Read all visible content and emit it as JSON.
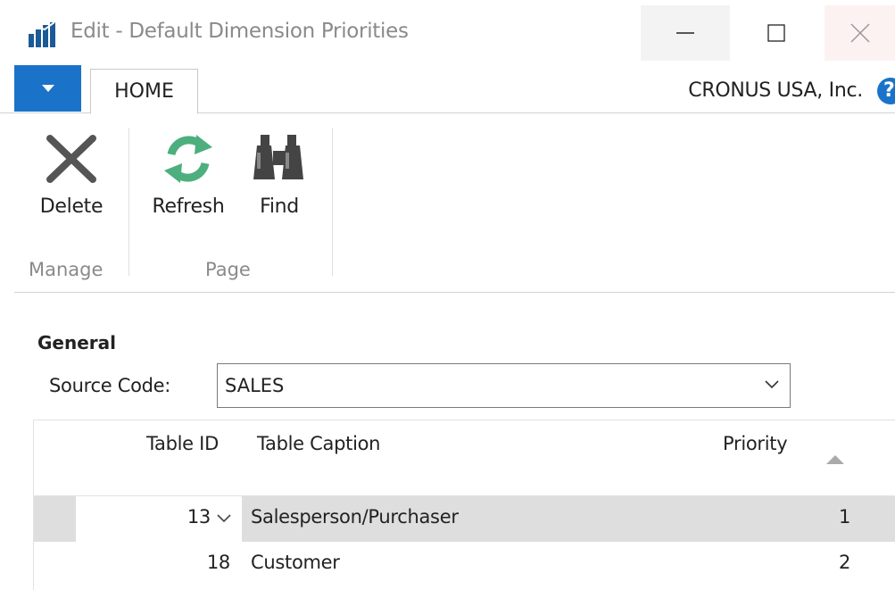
{
  "window": {
    "title": "Edit - Default Dimension Priorities"
  },
  "ribbon": {
    "tabs": [
      {
        "label": "HOME",
        "active": true
      }
    ],
    "company": "CRONUS USA, Inc.",
    "groups": [
      {
        "label": "Manage",
        "buttons": [
          {
            "label": "Delete",
            "icon": "close-x-icon"
          }
        ]
      },
      {
        "label": "Page",
        "buttons": [
          {
            "label": "Refresh",
            "icon": "refresh-icon"
          },
          {
            "label": "Find",
            "icon": "binoculars-icon"
          }
        ]
      }
    ]
  },
  "general": {
    "heading": "General",
    "source_code_label": "Source Code:",
    "source_code_value": "SALES"
  },
  "table": {
    "columns": [
      "Table ID",
      "Table Caption",
      "Priority"
    ],
    "rows": [
      {
        "table_id": "13",
        "caption": "Salesperson/Purchaser",
        "priority": "1",
        "selected": true
      },
      {
        "table_id": "18",
        "caption": "Customer",
        "priority": "2",
        "selected": false
      }
    ]
  },
  "colors": {
    "accent": "#1b73c9",
    "refresh_green": "#4caf7d",
    "selected_row": "#dedede"
  }
}
